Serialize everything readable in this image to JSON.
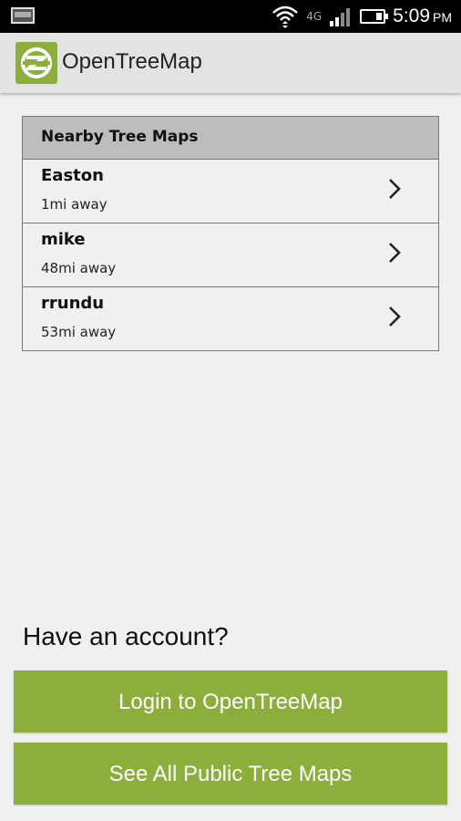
{
  "status_bar": {
    "network": "4G",
    "time": "5:09",
    "ampm": "PM"
  },
  "app": {
    "title": "OpenTreeMap",
    "brand_color": "#8caf3c"
  },
  "nearby": {
    "header": "Nearby Tree Maps",
    "items": [
      {
        "name": "Easton",
        "distance": "1mi away"
      },
      {
        "name": "mike",
        "distance": "48mi away"
      },
      {
        "name": "rrundu",
        "distance": "53mi away"
      }
    ]
  },
  "account": {
    "prompt": "Have an account?",
    "login_label": "Login to OpenTreeMap",
    "public_label": "See All Public Tree Maps"
  },
  "icons": {
    "logo": "opentreemap-logo-icon",
    "chevron": "chevron-right-icon"
  }
}
